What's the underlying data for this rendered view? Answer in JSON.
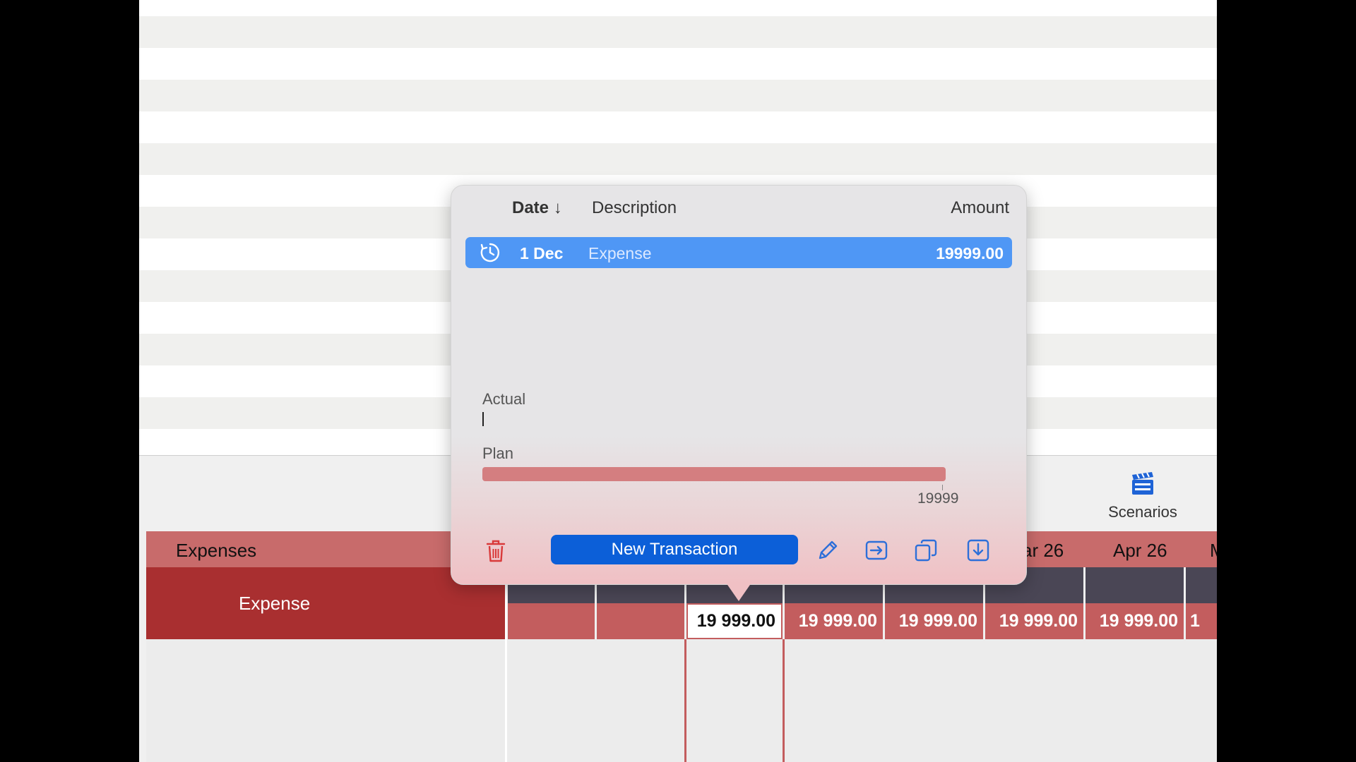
{
  "popover": {
    "columns": {
      "date": "Date",
      "description": "Description",
      "amount": "Amount"
    },
    "sort_arrow": "↓",
    "transaction": {
      "icon": "recurring-clock-icon",
      "date": "1 Dec",
      "description": "Expense",
      "amount": "19999.00"
    },
    "actual_label": "Actual",
    "plan_label": "Plan",
    "plan_value": "19999",
    "plan_fill_fraction": 1.0,
    "new_transaction_label": "New Transaction",
    "tool_icons": [
      "trash-icon",
      "pencil-icon",
      "move-icon",
      "duplicate-icon",
      "download-icon"
    ]
  },
  "toolbar": {
    "scenarios_label": "Scenarios",
    "scenarios_icon": "clapperboard-icon"
  },
  "grid": {
    "section_label": "Expenses",
    "row_label": "Expense",
    "months": [
      "ar 26",
      "Apr 26",
      "M"
    ],
    "values": [
      "",
      "",
      "19 999.00",
      "19 999.00",
      "19 999.00",
      "19 999.00",
      "19 999.00",
      "1"
    ]
  },
  "colors": {
    "accent": "#0c5fd8",
    "selection": "#4f97f5",
    "expense_dark": "#a92f30",
    "expense_light": "#c35d5e",
    "plan_bar": "#d47e80"
  }
}
